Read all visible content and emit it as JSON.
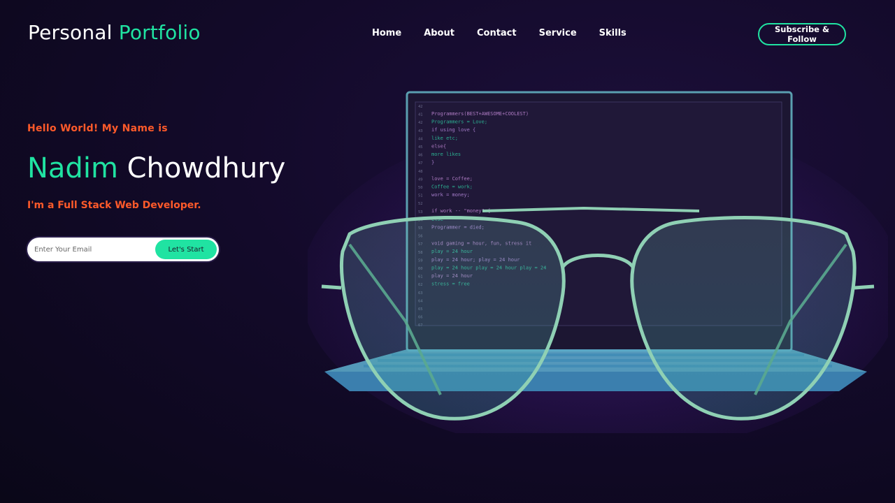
{
  "nav": {
    "brand_first": "Personal",
    "brand_second": "Portfolio",
    "links": [
      "Home",
      "About",
      "Contact",
      "Service",
      "Skills"
    ],
    "cta_label": "Subscribe & Follow"
  },
  "hero": {
    "greeting": "Hello World! My Name is",
    "first_name": "Nadim",
    "last_name": "Chowdhury",
    "role": "I'm a Full Stack Web Developer.",
    "email_placeholder": "Enter Your Email",
    "start_label": "Let's Start"
  },
  "code": {
    "line_numbers": [
      "42",
      "41",
      "42",
      "43",
      "44",
      "45",
      "46",
      "47",
      "48",
      "49",
      "50",
      "51",
      "52",
      "53",
      "54",
      "55",
      "56",
      "57",
      "58",
      "59",
      "60",
      "61",
      "62",
      "63",
      "64",
      "65",
      "66",
      "67"
    ],
    "lines": [
      "Programmers(BEST+AWESOME+COOLEST)",
      "Programmers = Love;",
      "if using love {",
      "   like etc;",
      "else{",
      "   more likes",
      "}",
      "",
      "love = Coffee;",
      "Coffee = work;",
      "work = money;",
      "",
      "if work -- \"money\" {",
      "   else",
      "      Programmer = died;",
      "",
      "void gaming = hour, fun, stress it",
      "      play = 24 hour",
      "      play = 24 hour; play = 24 hour",
      "      play = 24 hour play = 24 hour play = 24",
      "      play = 24 hour",
      "      stress = free"
    ]
  },
  "colors": {
    "accent": "#20e3a2",
    "highlight": "#ff5a2a",
    "background": "#130a2a"
  }
}
